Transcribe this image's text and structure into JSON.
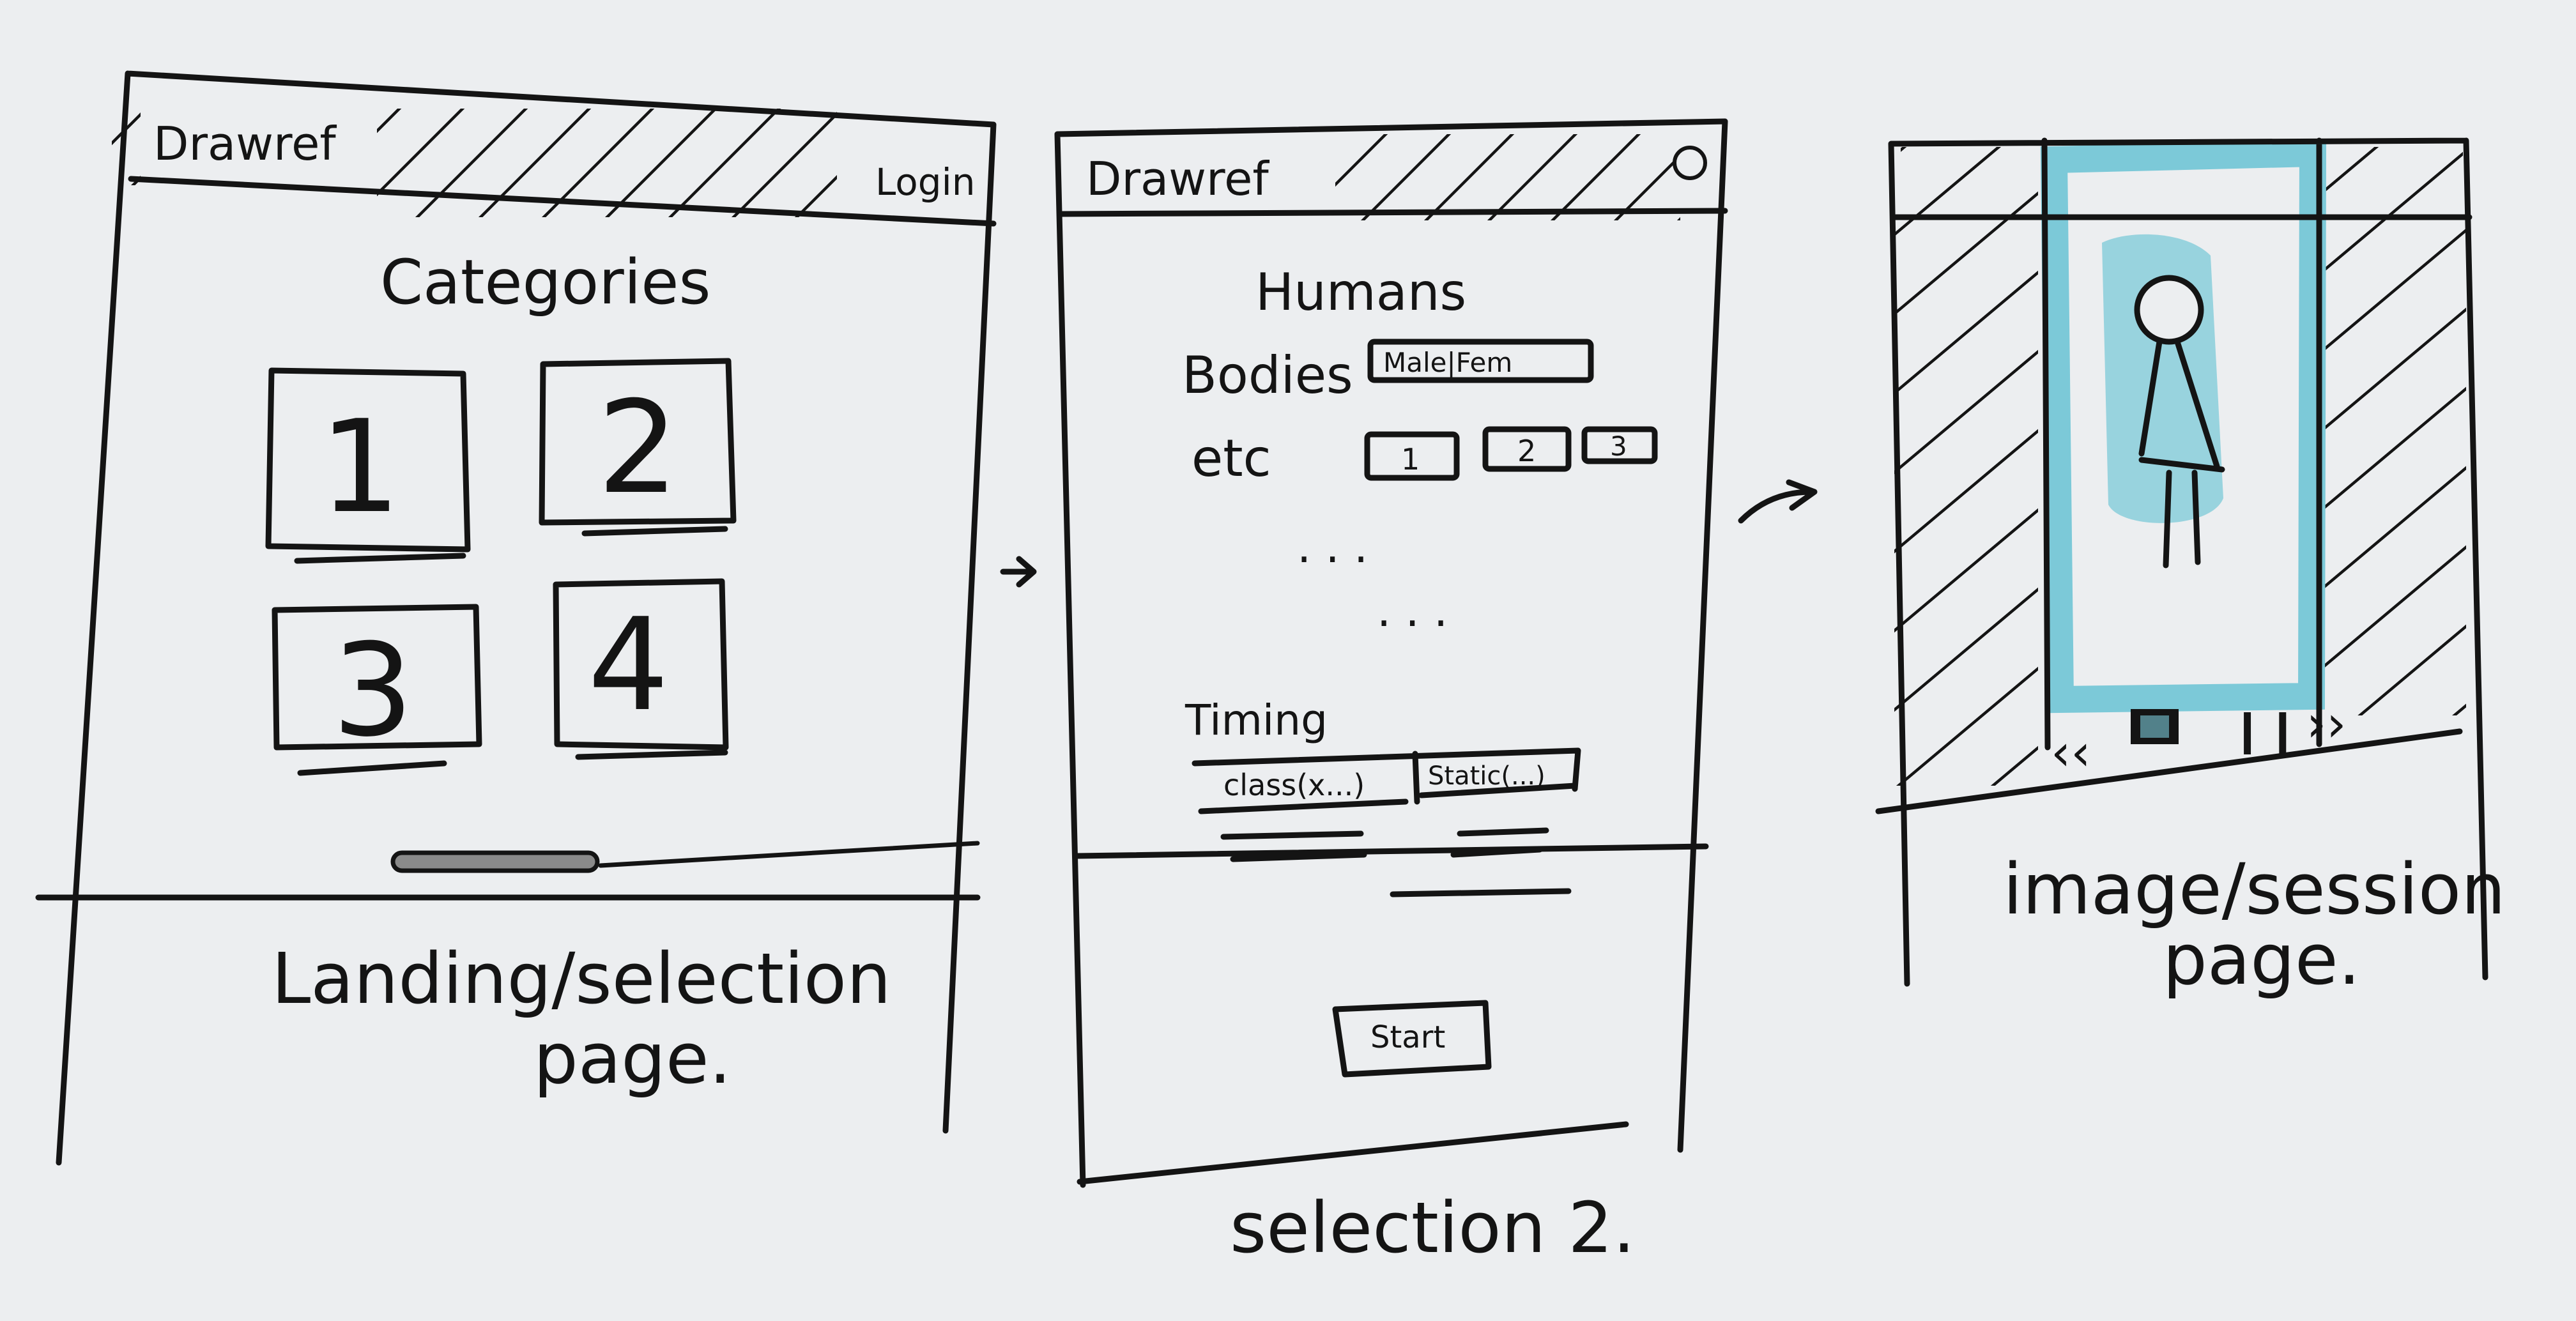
{
  "colors": {
    "paper": "#eceef0",
    "ink": "#141414",
    "marker_blue": "#7cc9d8"
  },
  "landing": {
    "brand": "Drawref",
    "login_label": "Login",
    "heading": "Categories",
    "tiles": [
      "1",
      "2",
      "3",
      "4"
    ],
    "caption_line1": "Landing/selection",
    "caption_line2": "page."
  },
  "selection2": {
    "brand": "Drawref",
    "profile_icon": "circle-icon",
    "heading": "Humans",
    "bodies_label": "Bodies",
    "bodies_toggle": "Male|Fem",
    "etc_label": "etc",
    "etc_options": [
      "1",
      "2",
      "3"
    ],
    "ellipsis": "· · ·",
    "timing_label": "Timing",
    "timing_options": [
      "class(x...)",
      "Static(...)"
    ],
    "start_label": "Start",
    "caption": "selection 2."
  },
  "session": {
    "controls": [
      "‹‹",
      "■",
      "❙❙",
      "››"
    ],
    "caption_line1": "image/session",
    "caption_line2": "page."
  }
}
